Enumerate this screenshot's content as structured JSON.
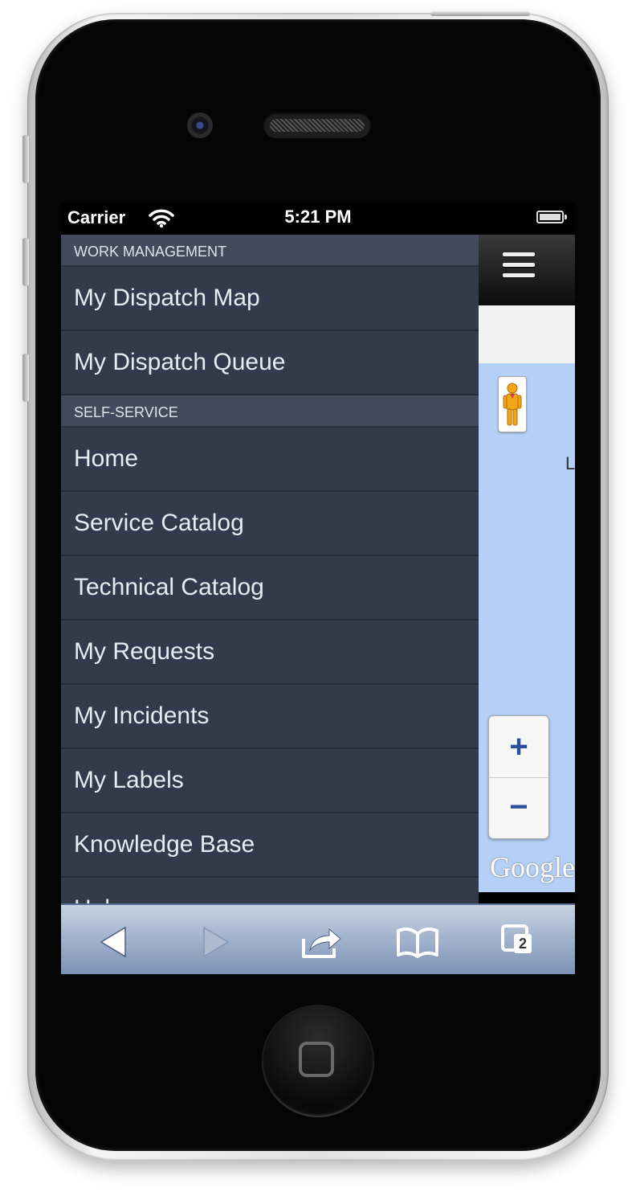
{
  "status_bar": {
    "carrier": "Carrier",
    "time": "5:21 PM"
  },
  "menu": {
    "sections": [
      {
        "title": "WORK MANAGEMENT",
        "items": [
          "My Dispatch Map",
          "My Dispatch Queue"
        ]
      },
      {
        "title": "SELF-SERVICE",
        "items": [
          "Home",
          "Service Catalog",
          "Technical Catalog",
          "My Requests",
          "My Incidents",
          "My Labels",
          "Knowledge Base",
          "Help"
        ]
      }
    ]
  },
  "map": {
    "label": "L",
    "zoom_in": "+",
    "zoom_out": "−",
    "logo": "Google"
  },
  "toolbar": {
    "tabs_count": "2"
  },
  "icons": [
    "wifi-icon",
    "battery-icon",
    "menu-icon",
    "pegman-icon",
    "back-icon",
    "forward-icon",
    "share-icon",
    "bookmarks-icon",
    "tabs-icon",
    "home-button-icon"
  ]
}
